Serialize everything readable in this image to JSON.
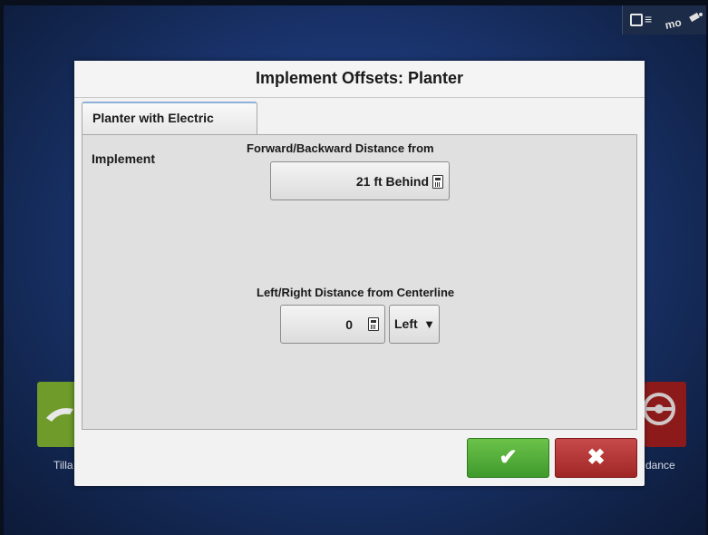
{
  "background_tiles": {
    "left_label": "Tilla",
    "right_label": "dance"
  },
  "status_bar": {
    "machine_icon": "machine-icon",
    "gps_icon": "gps-signal-icon"
  },
  "dialog": {
    "title": "Implement Offsets: Planter",
    "tab_label": "Planter with Electric",
    "section_label": "Implement",
    "forward_backward": {
      "label": "Forward/Backward Distance from",
      "value": "21 ft Behind",
      "icon": "calculator-icon"
    },
    "left_right": {
      "label": "Left/Right Distance from Centerline",
      "value": "0",
      "icon": "calculator-icon",
      "direction": "Left",
      "direction_arrow": "▼"
    },
    "ok_icon": "✔",
    "cancel_icon": "✖"
  },
  "colors": {
    "ok": "#4caf38",
    "cancel": "#b83434",
    "tab_accent": "#8fb0d8"
  }
}
